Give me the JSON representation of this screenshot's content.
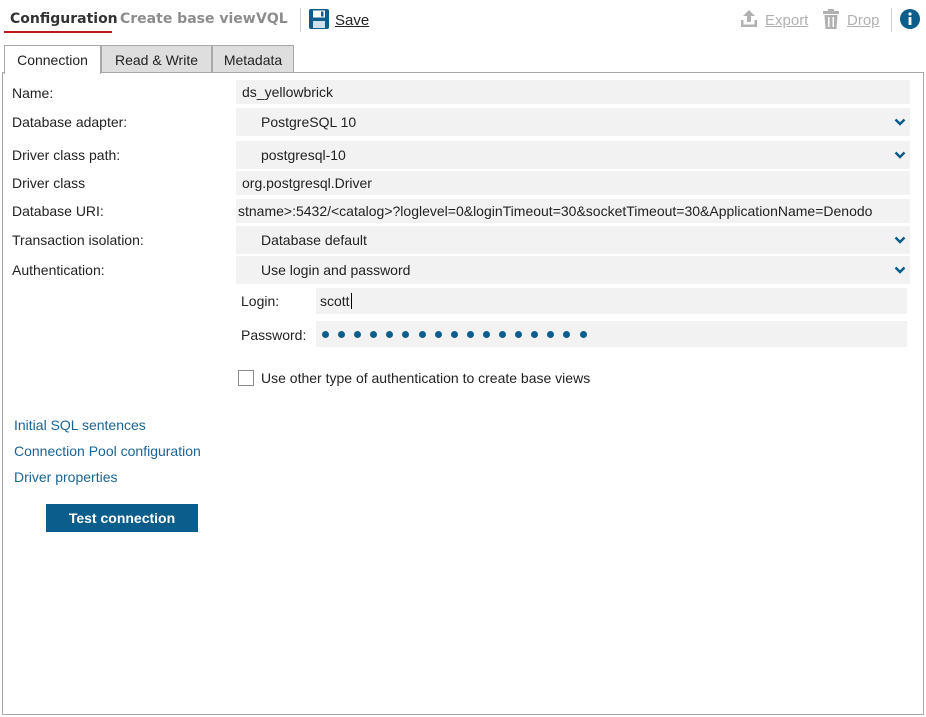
{
  "header": {
    "tabs": [
      {
        "label": "Configuration",
        "active": true
      },
      {
        "label": "Create base view",
        "active": false
      },
      {
        "label": "VQL",
        "active": false
      }
    ],
    "actions": {
      "save_label": "Save",
      "export_label": "Export",
      "drop_label": "Drop"
    },
    "icons": {
      "save": "floppy-disk-icon",
      "export": "upload-icon",
      "drop": "trash-icon",
      "info": "info-icon"
    }
  },
  "colors": {
    "accent": "#0b5d8c",
    "active_tab_underline": "#c4161c",
    "link": "#1a6496",
    "field_bg": "#f2f2f2"
  },
  "tabs": [
    {
      "label": "Connection",
      "active": true
    },
    {
      "label": "Read & Write",
      "active": false
    },
    {
      "label": "Metadata",
      "active": false
    }
  ],
  "form": {
    "name": {
      "label": "Name:",
      "value": "ds_yellowbrick"
    },
    "database_adapter": {
      "label": "Database adapter:",
      "value": "PostgreSQL 10"
    },
    "driver_class_path": {
      "label": "Driver class path:",
      "value": "postgresql-10"
    },
    "driver_class": {
      "label": "Driver class",
      "value": "org.postgresql.Driver"
    },
    "database_uri": {
      "label": "Database URI:",
      "value": "stname>:5432/<catalog>?loglevel=0&loginTimeout=30&socketTimeout=30&ApplicationName=Denodo"
    },
    "transaction_isolation": {
      "label": "Transaction isolation:",
      "value": "Database default"
    },
    "authentication": {
      "label": "Authentication:",
      "value": "Use login and password"
    },
    "login": {
      "label": "Login:",
      "value": "scott"
    },
    "password": {
      "label": "Password:",
      "masked_length": 17
    },
    "other_auth": {
      "label": "Use other type of authentication to create base views",
      "checked": false
    }
  },
  "links": {
    "initial_sql": "Initial SQL sentences",
    "connection_pool": "Connection Pool configuration",
    "driver_properties": "Driver properties"
  },
  "buttons": {
    "test_connection": "Test connection"
  }
}
